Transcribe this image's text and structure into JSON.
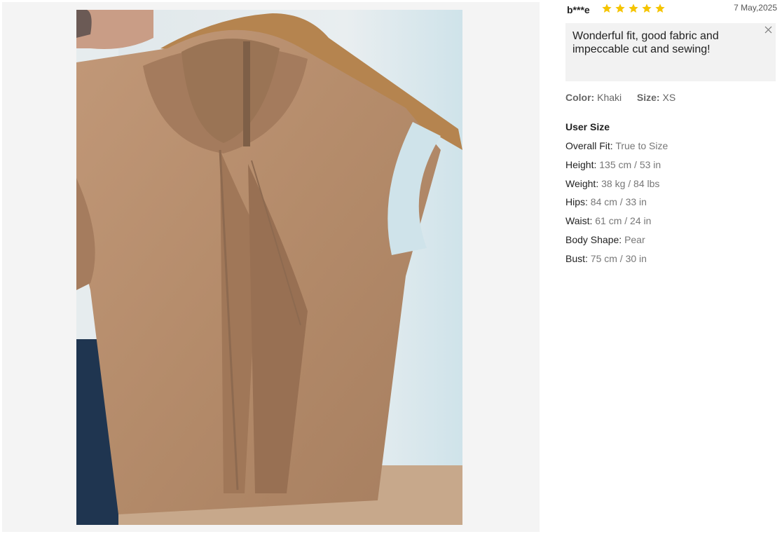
{
  "review": {
    "reviewer": "b***e",
    "rating": 5,
    "date": "7 May,2025",
    "text": "Wonderful fit, good fabric and impeccable cut and sewing!"
  },
  "variant": {
    "color_label": "Color:",
    "color_value": "Khaki",
    "size_label": "Size:",
    "size_value": "XS"
  },
  "user_size": {
    "title": "User Size",
    "rows": [
      {
        "label": "Overall Fit:",
        "value": "True to Size"
      },
      {
        "label": "Height:",
        "value": "135 cm / 53 in"
      },
      {
        "label": "Weight:",
        "value": "38 kg / 84 lbs"
      },
      {
        "label": "Hips:",
        "value": "84 cm / 33 in"
      },
      {
        "label": "Waist:",
        "value": "61 cm / 24 in"
      },
      {
        "label": "Body Shape:",
        "value": "Pear"
      },
      {
        "label": "Bust:",
        "value": "75 cm / 30 in"
      }
    ]
  },
  "colors": {
    "star": "#f5c400",
    "review_bg": "#f2f2f2",
    "garment": "#b98f6e"
  },
  "icons": {
    "star": "star-icon",
    "close": "close-icon"
  }
}
